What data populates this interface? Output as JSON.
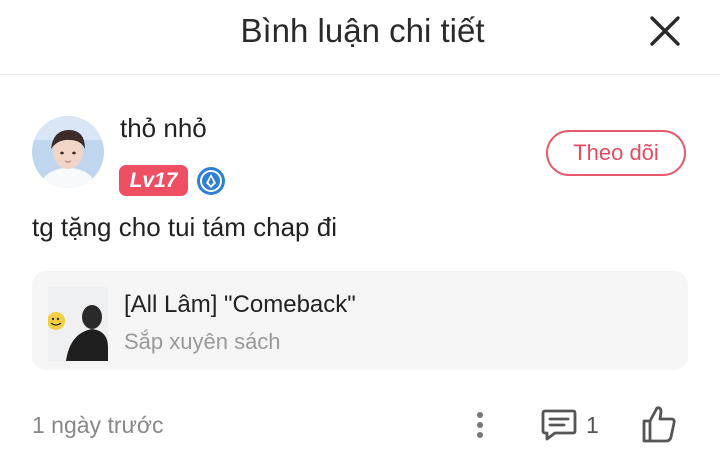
{
  "header": {
    "title": "Bình luận chi tiết",
    "close_icon": "close-icon"
  },
  "user": {
    "name": "thỏ nhỏ",
    "level": "Lv17",
    "follow_label": "Theo dõi",
    "level_color": "#ef4f63",
    "vip_icon": "vip-crest-icon"
  },
  "comment": {
    "text": "tg tặng cho tui tám chap đi"
  },
  "book": {
    "title": "[All Lâm] \"Comeback\"",
    "status": "Sắp xuyên sách"
  },
  "footer": {
    "timestamp": "1 ngày trước",
    "reply_count": "1",
    "more_icon": "more-vertical-icon",
    "reply_icon": "comment-icon",
    "like_icon": "thumbs-up-icon"
  },
  "colors": {
    "accent": "#e14d60",
    "muted": "#888888",
    "card_bg": "#f5f5f5"
  }
}
